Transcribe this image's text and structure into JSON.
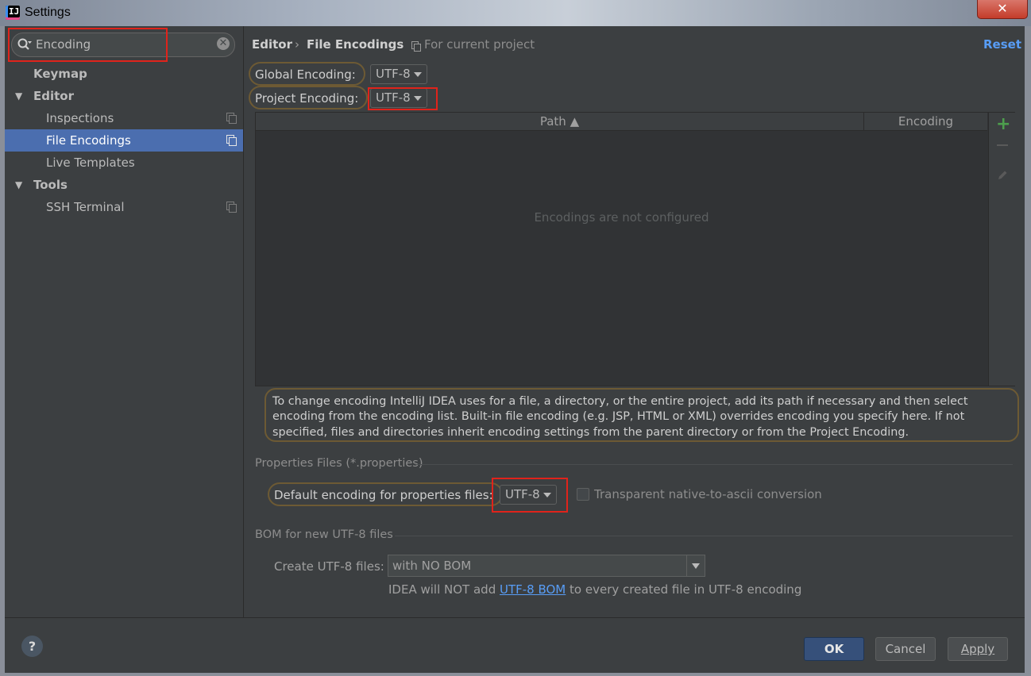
{
  "window": {
    "title": "Settings",
    "close_label": "✕"
  },
  "search": {
    "value": "Encoding"
  },
  "sidebar": {
    "items": [
      {
        "label": "Keymap"
      },
      {
        "label": "Editor"
      },
      {
        "label": "Inspections"
      },
      {
        "label": "File Encodings"
      },
      {
        "label": "Live Templates"
      },
      {
        "label": "Tools"
      },
      {
        "label": "SSH Terminal"
      }
    ],
    "expand_glyph": "▼"
  },
  "breadcrumb": {
    "parent": "Editor",
    "separator": "›",
    "current": "File Encodings",
    "scope": "For current project"
  },
  "reset_label": "Reset",
  "global_encoding": {
    "label": "Global Encoding:",
    "value": "UTF-8"
  },
  "project_encoding": {
    "label": "Project Encoding:",
    "value": "UTF-8"
  },
  "table": {
    "columns": [
      "Path ▲",
      "Encoding"
    ],
    "empty_text": "Encodings are not configured",
    "add_label": "+"
  },
  "info_text": "To change encoding IntelliJ IDEA uses for a file, a directory, or the entire project, add its path if necessary and then select encoding from the encoding list. Built-in file encoding (e.g. JSP, HTML or XML) overrides encoding you specify here. If not specified, files and directories inherit encoding settings from the parent directory or from the Project Encoding.",
  "properties": {
    "section_title": "Properties Files (*.properties)",
    "label": "Default encoding for properties files:",
    "value": "UTF-8",
    "checkbox_label": "Transparent native-to-ascii conversion",
    "checkbox_checked": false
  },
  "bom": {
    "section_title": "BOM for new UTF-8 files",
    "label": "Create UTF-8 files:",
    "value": "with NO BOM",
    "note_before": "IDEA will NOT add ",
    "note_link": "UTF-8 BOM",
    "note_after": " to every created file in UTF-8 encoding"
  },
  "footer": {
    "help_label": "?",
    "ok_label": "OK",
    "cancel_label": "Cancel",
    "apply_label": "Apply"
  },
  "colors": {
    "selection": "#4b6eaf",
    "link": "#589df6",
    "highlight_box": "#e0231b",
    "add_icon": "#4d9e4d"
  }
}
